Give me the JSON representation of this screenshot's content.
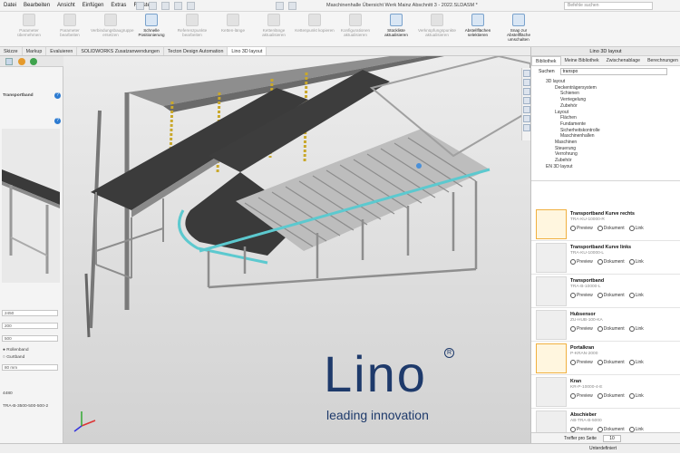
{
  "menu": {
    "items": [
      "Datei",
      "Bearbeiten",
      "Ansicht",
      "Einfügen",
      "Extras",
      "Fenster"
    ],
    "title": "Maschinenhalle Übersicht Werk Mainz Abschnitt 3 - 2022.SLDASM *",
    "search_placeholder": "Befehle suchen"
  },
  "ribbon": {
    "buttons": [
      {
        "label": "Parameter übernehmen",
        "active": false
      },
      {
        "label": "Parameter bearbeiten",
        "active": false
      },
      {
        "label": "Verbindungsbaugruppe ersetzen",
        "active": false
      },
      {
        "label": "Schnelle Positionierung",
        "active": true
      },
      {
        "label": "Referenzpunkte bearbeiten",
        "active": false
      },
      {
        "label": "Ketten-länge",
        "active": false
      },
      {
        "label": "Kettenlänge aktualisieren",
        "active": false
      },
      {
        "label": "Kettenpunkt kopieren",
        "active": false
      },
      {
        "label": "Konfigurationen aktualisieren",
        "active": false
      },
      {
        "label": "Stückliste aktualisieren",
        "active": true
      },
      {
        "label": "Verknüpfungspunkte aktualisieren",
        "active": false
      },
      {
        "label": "Abstellflächen selektieren",
        "active": true
      },
      {
        "label": "Snap zur Abstellfläche umschalten",
        "active": true
      }
    ]
  },
  "doc_tabs": [
    "Skizze",
    "Markup",
    "Evaluieren",
    "SOLIDWORKS Zusatzanwendungen",
    "Tecton Design Automation",
    "Lino 3D layout"
  ],
  "doc_tabs_active": 5,
  "left_panel": {
    "heading": "Transportband",
    "fields": [
      "2450",
      "200",
      "500"
    ],
    "options": [
      "Rollenband",
      "Gurtband"
    ],
    "dropdown": "80 mm",
    "id_value": "4480",
    "code_value": "TRA-B-3500-500-500-2"
  },
  "right_panel": {
    "title": "Lino 3D layout",
    "tabs": [
      "Bibliothek",
      "Meine Bibliothek",
      "Zwischenablage",
      "Berechnungen"
    ],
    "search_label": "Suchen",
    "search_value": "transpo",
    "tree": [
      {
        "level": "l1",
        "text": "3D layout"
      },
      {
        "level": "l2",
        "text": "Deckenträgersystem"
      },
      {
        "level": "l3",
        "text": "Schienen"
      },
      {
        "level": "l3",
        "text": "Verriegelung"
      },
      {
        "level": "l3",
        "text": "Zubehör"
      },
      {
        "level": "l2",
        "text": "Layout"
      },
      {
        "level": "l3",
        "text": "Flächen"
      },
      {
        "level": "l3",
        "text": "Fundamente"
      },
      {
        "level": "l3",
        "text": "Sicherheitskontrolle"
      },
      {
        "level": "l3",
        "text": "Maschinenhallen"
      },
      {
        "level": "l2",
        "text": "Maschinen"
      },
      {
        "level": "l2",
        "text": "Steuerung"
      },
      {
        "level": "l2",
        "text": "Verrohrung"
      },
      {
        "level": "l2",
        "text": "Zubehör"
      },
      {
        "level": "l1",
        "text": "EN 3D layout"
      }
    ],
    "cards": [
      {
        "name": "Transportband Kurve rechts",
        "code": "TRA-KU-10000-R",
        "selected": true
      },
      {
        "name": "Transportband Kurve links",
        "code": "TRA-KU-10000-L",
        "selected": false
      },
      {
        "name": "Transportband",
        "code": "TRA-B-10000-L",
        "selected": false
      },
      {
        "name": "Hubsensor",
        "code": "ZU-HUB-100-KA",
        "selected": false
      },
      {
        "name": "Portalkran",
        "code": "P-KRAN-2000",
        "selected": true
      },
      {
        "name": "Kran",
        "code": "KR-P-10000-4-E",
        "selected": false
      },
      {
        "name": "Abschieber",
        "code": "AB-TRA-B-5000",
        "selected": false
      }
    ],
    "card_actions": {
      "preview": "Preview",
      "document": "Dokument",
      "link": "Link"
    },
    "bottom_label": "Treffer pro Seite",
    "bottom_value": "10"
  },
  "logo": {
    "word": "Lino",
    "tagline": "leading innovation",
    "mark": "R"
  },
  "status": {
    "text": "Unterdefiniert"
  }
}
